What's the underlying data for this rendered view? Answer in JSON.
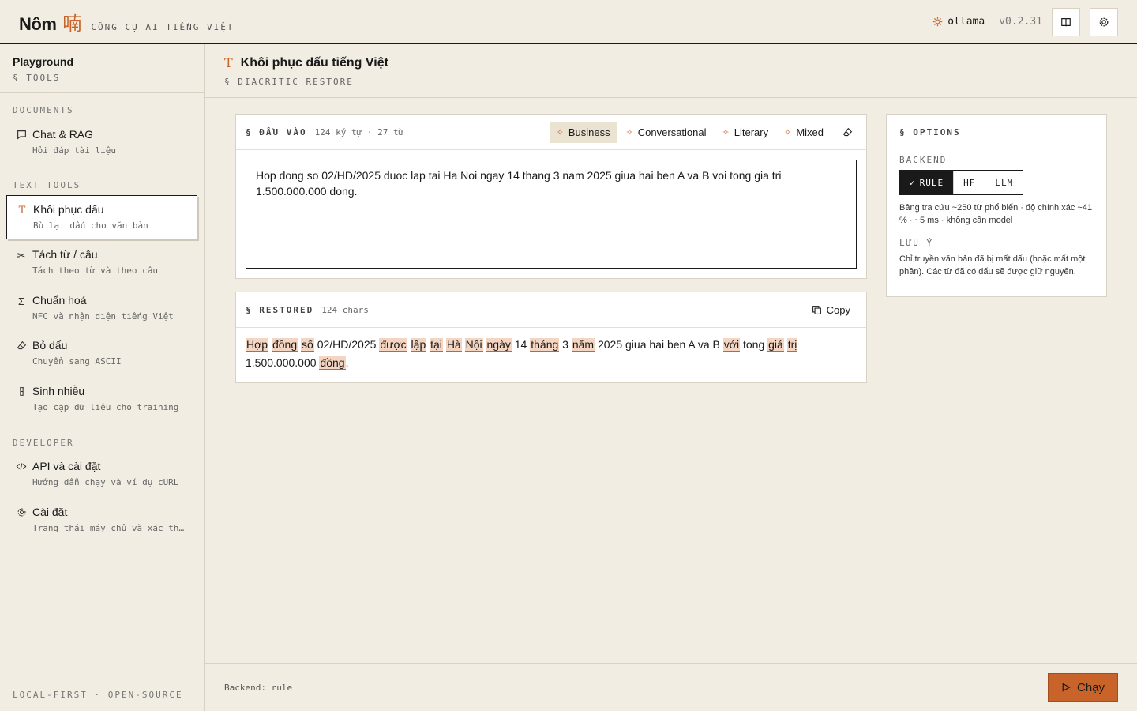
{
  "header": {
    "brand": "Nôm",
    "brand_glyph": "喃",
    "tagline": "CÔNG CỤ AI TIẾNG VIỆT",
    "engine": "ollama",
    "version": "v0.2.31"
  },
  "sidebar": {
    "title": "Playground",
    "subtitle": "§ TOOLS",
    "groups": [
      "DOCUMENTS",
      "TEXT TOOLS",
      "DEVELOPER"
    ],
    "items": [
      {
        "label": "Chat & RAG",
        "desc": "Hỏi đáp tài liệu",
        "icon": "chat-icon"
      },
      {
        "label": "Khôi phục dấu",
        "desc": "Bù lại dấu cho văn bản",
        "icon": "text-icon"
      },
      {
        "label": "Tách từ / câu",
        "desc": "Tách theo từ và theo câu",
        "icon": "scissors-icon"
      },
      {
        "label": "Chuẩn hoá",
        "desc": "NFC và nhận diện tiếng Việt",
        "icon": "sigma-icon"
      },
      {
        "label": "Bỏ dấu",
        "desc": "Chuyển sang ASCII",
        "icon": "eraser-icon"
      },
      {
        "label": "Sinh nhiễu",
        "desc": "Tạo cặp dữ liệu cho training",
        "icon": "flask-icon"
      },
      {
        "label": "API và cài đặt",
        "desc": "Hướng dẫn chạy và ví dụ cURL",
        "icon": "code-icon"
      },
      {
        "label": "Cài đặt",
        "desc": "Trạng thái máy chủ và xác thực",
        "icon": "gear-icon"
      }
    ],
    "footer": "LOCAL-FIRST · OPEN-SOURCE"
  },
  "page": {
    "title": "Khôi phục dấu tiếng Việt",
    "subtitle": "§ DIACRITIC RESTORE"
  },
  "input": {
    "label": "§ ĐẦU VÀO",
    "meta": "124 ký tự · 27 từ",
    "presets": [
      "Business",
      "Conversational",
      "Literary",
      "Mixed"
    ],
    "active_preset": "Business",
    "value": "Hop dong so 02/HD/2025 duoc lap tai Ha Noi ngay 14 thang 3 nam 2025 giua hai ben A va B voi tong gia tri 1.500.000.000 dong."
  },
  "output": {
    "label": "§ RESTORED",
    "meta": "124 chars",
    "copy_label": "Copy",
    "tokens": [
      {
        "t": "Hợp",
        "h": true
      },
      {
        "t": " "
      },
      {
        "t": "đồng",
        "h": true
      },
      {
        "t": " "
      },
      {
        "t": "số",
        "h": true
      },
      {
        "t": " 02/HD/2025 "
      },
      {
        "t": "được",
        "h": true
      },
      {
        "t": " "
      },
      {
        "t": "lập",
        "h": true
      },
      {
        "t": " "
      },
      {
        "t": "tại",
        "h": true
      },
      {
        "t": " "
      },
      {
        "t": "Hà",
        "h": true
      },
      {
        "t": " "
      },
      {
        "t": "Nội",
        "h": true
      },
      {
        "t": " "
      },
      {
        "t": "ngày",
        "h": true
      },
      {
        "t": " 14 "
      },
      {
        "t": "tháng",
        "h": true
      },
      {
        "t": " 3 "
      },
      {
        "t": "năm",
        "h": true
      },
      {
        "t": " 2025 giua hai ben A va B "
      },
      {
        "t": "với",
        "h": true
      },
      {
        "t": " tong "
      },
      {
        "t": "giá",
        "h": true
      },
      {
        "t": " "
      },
      {
        "t": "trị",
        "h": true
      },
      {
        "t": " 1.500.000.000 "
      },
      {
        "t": "đồng",
        "h": true
      },
      {
        "t": "."
      }
    ]
  },
  "options": {
    "title": "§ OPTIONS",
    "backend_label": "BACKEND",
    "backends": [
      "RULE",
      "HF",
      "LLM"
    ],
    "active_backend": "RULE",
    "backend_desc": "Bảng tra cứu ~250 từ phổ biến · độ chính xác ~41 % · ~5 ms · không cần model",
    "note_label": "LƯU Ý",
    "note": "Chỉ truyền văn bản đã bị mất dấu (hoặc mất một phần). Các từ đã có dấu sẽ được giữ nguyên."
  },
  "footer": {
    "status": "Backend: rule",
    "run_label": "Chạy"
  },
  "colors": {
    "accent": "#c8642a",
    "background": "#f1ede3",
    "highlight": "#f3d5c2"
  }
}
